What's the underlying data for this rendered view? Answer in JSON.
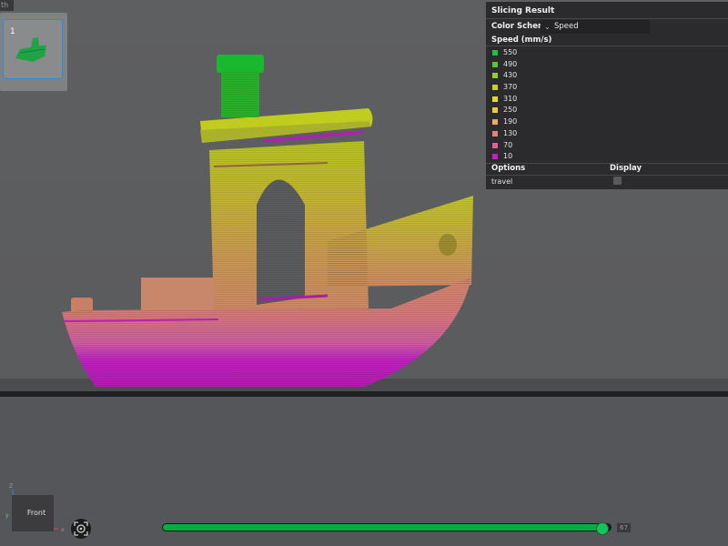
{
  "top_strip": {
    "label": "th"
  },
  "plate": {
    "number": "1"
  },
  "slicing_panel": {
    "title": "Slicing Result",
    "color_scheme_label": "Color Scheme",
    "color_scheme_value": "Speed",
    "speed_header": "Speed (mm/s)",
    "legend": [
      {
        "value": "550",
        "color": "#1bc33b"
      },
      {
        "value": "490",
        "color": "#57c92a"
      },
      {
        "value": "430",
        "color": "#93cf24"
      },
      {
        "value": "370",
        "color": "#c4d41f"
      },
      {
        "value": "310",
        "color": "#e4dc19"
      },
      {
        "value": "250",
        "color": "#efc93a"
      },
      {
        "value": "190",
        "color": "#efa863"
      },
      {
        "value": "130",
        "color": "#e48476"
      },
      {
        "value": "70",
        "color": "#e05e98"
      },
      {
        "value": "10",
        "color": "#c81ec4"
      }
    ],
    "options_label": "Options",
    "display_label": "Display",
    "travel_label": "travel",
    "travel_checked": false
  },
  "view": {
    "cube_label": "Front",
    "axis_z": "Z",
    "axis_y": "y",
    "axis_x": "x"
  },
  "layer_slider": {
    "value": "67",
    "progress": 0.985
  },
  "icons": {
    "focus": "focus-target-icon",
    "thumb": "model-thumbnail-icon"
  }
}
